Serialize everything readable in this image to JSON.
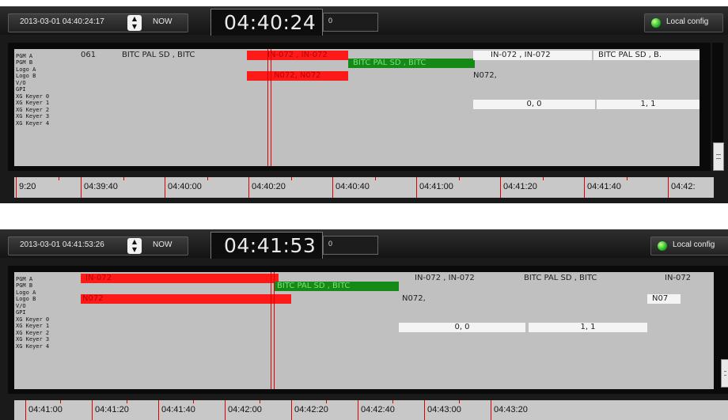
{
  "panels": [
    {
      "datetime": "2013-03-01 04:40:24:17",
      "now_label": "NOW",
      "clock": "04:40:24",
      "counter": "0",
      "local_config": "Local config",
      "track_labels": [
        "PGM A",
        "PGM B",
        "Logo A",
        "Logo B",
        "V/O",
        "GPI",
        "XG Keyer 0",
        "XG Keyer 1",
        "XG Keyer 2",
        "XG Keyer 3",
        "XG Keyer 4"
      ],
      "events": {
        "e1": "061",
        "e2": "BITC PAL SD , BITC",
        "e3": "IN-072 , IN-072",
        "e4": "BITC PAL SD , BITC",
        "e5": "IN-072 , IN-072",
        "e6": "BITC PAL SD , B.",
        "e7": "N072, N072",
        "e8": "N072,",
        "e9": "0, 0",
        "e10": "1, 1"
      },
      "ruler": [
        "9:20",
        "04:39:40",
        "04:40:00",
        "04:40:20",
        "04:40:40",
        "04:41:00",
        "04:41:20",
        "04:41:40",
        "04:42:"
      ]
    },
    {
      "datetime": "2013-03-01 04:41:53:26",
      "now_label": "NOW",
      "clock": "04:41:53",
      "counter": "0",
      "local_config": "Local config",
      "track_labels": [
        "PGM A",
        "PGM B",
        "Logo A",
        "Logo B",
        "V/O",
        "GPI",
        "XG Keyer 0",
        "XG Keyer 1",
        "XG Keyer 2",
        "XG Keyer 3",
        "XG Keyer 4"
      ],
      "events": {
        "e1": "IN-072",
        "e2": "BITC PAL SD , BITC",
        "e3": "IN-072 , IN-072",
        "e4": "BITC PAL SD , BITC",
        "e5": "IN-072",
        "e6": "N072",
        "e7": "N072,",
        "e8": "N07",
        "e9": "0, 0",
        "e10": "1, 1"
      },
      "ruler": [
        "04:41:00",
        "04:41:20",
        "04:41:40",
        "04:42:00",
        "04:42:20",
        "04:42:40",
        "04:43:00",
        "04:43:20"
      ]
    }
  ]
}
